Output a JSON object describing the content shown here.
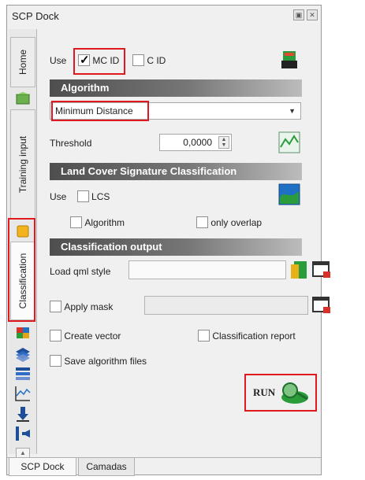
{
  "window": {
    "title": "SCP Dock",
    "title_icons": [
      "float-icon",
      "close-icon"
    ]
  },
  "vertical_tabs": [
    {
      "label": "Home"
    },
    {
      "label": "Training input"
    },
    {
      "label": "Classification",
      "active": true
    }
  ],
  "use_row": {
    "use_label": "Use",
    "mc_id_label": "MC ID",
    "mc_id_checked": true,
    "c_id_label": "C ID",
    "c_id_checked": false
  },
  "algorithm": {
    "header": "Algorithm",
    "selected": "Minimum Distance",
    "threshold_label": "Threshold",
    "threshold_value": "0,0000"
  },
  "lcs": {
    "header": "Land Cover Signature Classification",
    "use_label": "Use",
    "lcs_label": "LCS",
    "algorithm_label": "Algorithm",
    "only_overlap_label": "only overlap"
  },
  "output": {
    "header": "Classification output",
    "load_qml_label": "Load qml style",
    "apply_mask_label": "Apply mask",
    "create_vector_label": "Create vector",
    "classification_report_label": "Classification report",
    "save_algorithm_files_label": "Save algorithm files"
  },
  "run_label": "RUN",
  "bottom_tabs": [
    {
      "label": "SCP Dock",
      "active": true
    },
    {
      "label": "Camadas"
    }
  ],
  "colors": {
    "highlight": "#e0191f",
    "section_header": "#4e4e4e"
  }
}
